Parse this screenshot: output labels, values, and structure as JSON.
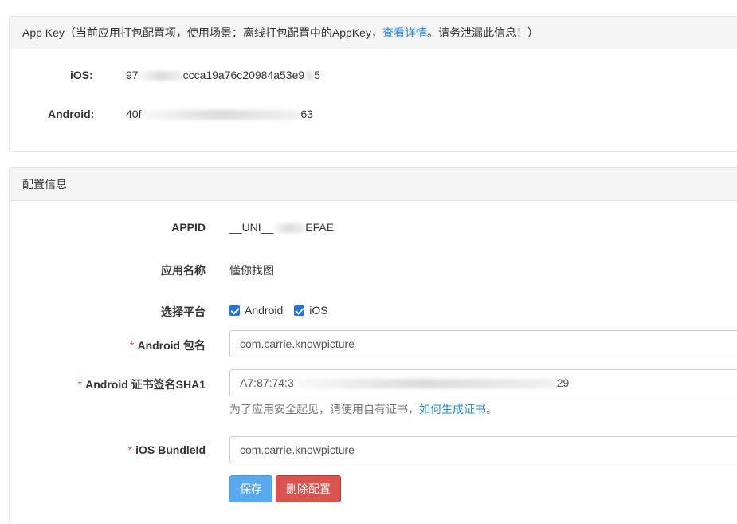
{
  "appkey_panel": {
    "header_prefix": "App Key（当前应用打包配置项，使用场景：离线打包配置中的AppKey，",
    "header_link": "查看详情",
    "header_suffix": "。请务泄漏此信息！）",
    "ios_label": "iOS:",
    "ios_value_start": "97",
    "ios_value_mid": "ccca19a76c20984a53e9",
    "ios_value_end": "5",
    "android_label": "Android:",
    "android_value_start": "40f",
    "android_value_end": "63"
  },
  "config_panel": {
    "header": "配置信息",
    "appid_label": "APPID",
    "appid_value_start": "__UNI__",
    "appid_value_end": "EFAE",
    "app_name_label": "应用名称",
    "app_name_value": "懂你找图",
    "platform_label": "选择平台",
    "platform_android": "Android",
    "platform_ios": "iOS",
    "required_mark": "*",
    "android_package_label": "Android 包名",
    "android_package_value": "com.carrie.knowpicture",
    "android_sha1_label": "Android 证书签名SHA1",
    "android_sha1_value_start": "A7:87:74:3",
    "android_sha1_value_end": "29",
    "hint_text": "为了应用安全起见，请使用自有证书，",
    "hint_link": "如何生成证书",
    "hint_end": "。",
    "ios_bundle_label": "iOS BundleId",
    "ios_bundle_value": "com.carrie.knowpicture",
    "save_button": "保存",
    "delete_button": "删除配置"
  },
  "colors": {
    "link": "#1e88e5",
    "save_button": "#5aa9ef",
    "delete_button": "#d9534f",
    "checkbox": "#1a73e8",
    "required": "#d9534f"
  }
}
